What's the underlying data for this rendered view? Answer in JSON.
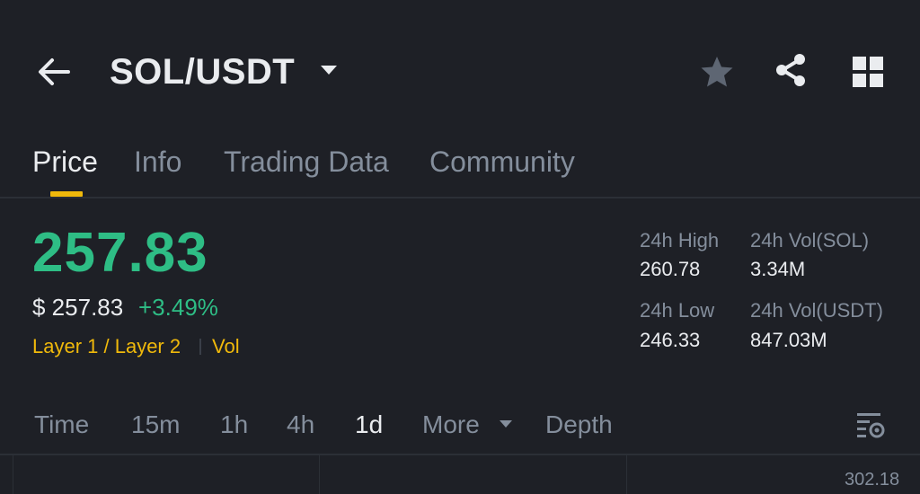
{
  "header": {
    "pair": "SOL/USDT",
    "icons": [
      "arrow-left-icon",
      "caret-down-icon",
      "star-icon",
      "share-icon",
      "grid-icon"
    ]
  },
  "tabs": [
    {
      "label": "Price",
      "active": true
    },
    {
      "label": "Info",
      "active": false
    },
    {
      "label": "Trading Data",
      "active": false
    },
    {
      "label": "Community",
      "active": false
    }
  ],
  "price": {
    "last": "257.83",
    "usd": "$ 257.83",
    "change": "+3.49%",
    "tags": [
      "Layer 1 / Layer 2",
      "Vol"
    ]
  },
  "stats": {
    "high_label": "24h High",
    "high_value": "260.78",
    "low_label": "24h Low",
    "low_value": "246.33",
    "vol_base_label": "24h Vol(SOL)",
    "vol_base_value": "3.34M",
    "vol_quote_label": "24h Vol(USDT)",
    "vol_quote_value": "847.03M"
  },
  "intervals": [
    {
      "label": "Time",
      "active": false
    },
    {
      "label": "15m",
      "active": false
    },
    {
      "label": "1h",
      "active": false
    },
    {
      "label": "4h",
      "active": false
    },
    {
      "label": "1d",
      "active": true
    },
    {
      "label": "More",
      "active": false
    },
    {
      "label": "Depth",
      "active": false
    }
  ],
  "chart": {
    "axis_top_label": "302.18"
  },
  "colors": {
    "background": "#1e2026",
    "up": "#2ebd85",
    "accent": "#f0b90b",
    "muted": "#848e9c",
    "text": "#eaecef"
  }
}
